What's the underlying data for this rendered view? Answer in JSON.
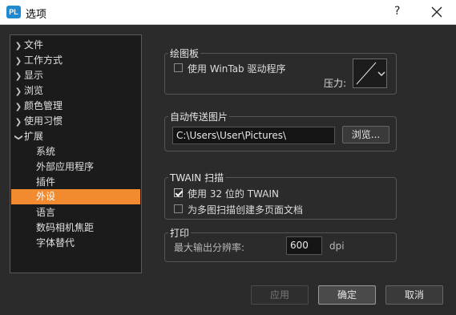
{
  "window": {
    "title": "选项",
    "logo_text": "PL",
    "help": "?"
  },
  "tree": {
    "items": [
      {
        "label": "文件"
      },
      {
        "label": "工作方式"
      },
      {
        "label": "显示"
      },
      {
        "label": "浏览"
      },
      {
        "label": "颜色管理"
      },
      {
        "label": "使用习惯"
      },
      {
        "label": "扩展"
      },
      {
        "label": "系统"
      },
      {
        "label": "外部应用程序"
      },
      {
        "label": "插件"
      },
      {
        "label": "外设"
      },
      {
        "label": "语言"
      },
      {
        "label": "数码相机焦距"
      },
      {
        "label": "字体替代"
      }
    ],
    "selected": "外设"
  },
  "tablet": {
    "title": "绘图板",
    "wintab_label": "使用 WinTab 驱动程序",
    "wintab_checked": false,
    "pressure_label": "压力:"
  },
  "auto_send": {
    "title": "自动传送图片",
    "path": "C:\\Users\\User\\Pictures\\",
    "browse_label": "浏览..."
  },
  "twain": {
    "title": "TWAIN 扫描",
    "use32_label": "使用 32 位的 TWAIN",
    "use32_checked": true,
    "multipage_label": "为多图扫描创建多页面文档",
    "multipage_checked": false
  },
  "print": {
    "title": "打印",
    "max_res_label": "最大输出分辨率:",
    "max_res_value": "600",
    "unit": "dpi"
  },
  "footer": {
    "apply": "应用",
    "ok": "确定",
    "cancel": "取消"
  },
  "colors": {
    "selection": "#f28a30",
    "background": "#2b2b2b"
  }
}
